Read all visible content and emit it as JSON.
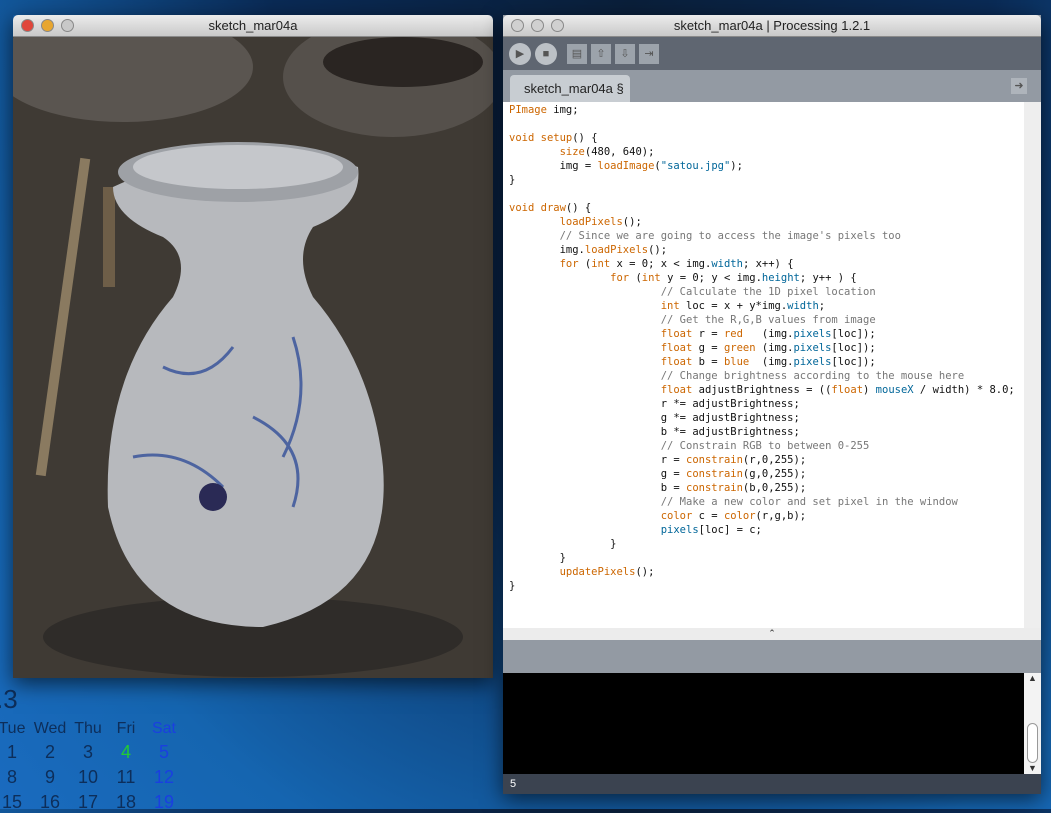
{
  "sketch_window": {
    "title": "sketch_mar04a"
  },
  "ide": {
    "title": "sketch_mar04a | Processing 1.2.1",
    "toolbar": {
      "run": "▶",
      "stop": "■",
      "new": "▤",
      "open": "⇧",
      "save": "⇩",
      "export": "⇥"
    },
    "tab_label": "sketch_mar04a §",
    "tab_menu": "➜",
    "status_line": "5",
    "code": [
      [
        [
          "PImage",
          "k"
        ],
        [
          " img;",
          ""
        ]
      ],
      [],
      [
        [
          "void",
          "k"
        ],
        [
          " ",
          ""
        ],
        [
          "setup",
          "k"
        ],
        [
          "() {",
          ""
        ]
      ],
      [
        [
          "\t",
          ""
        ],
        [
          "size",
          "k"
        ],
        [
          "(480, 640);",
          ""
        ]
      ],
      [
        [
          "\timg = ",
          ""
        ],
        [
          "loadImage",
          "k"
        ],
        [
          "(",
          ""
        ],
        [
          "\"satou.jpg\"",
          "s"
        ],
        [
          ");",
          ""
        ]
      ],
      [
        [
          "}",
          ""
        ]
      ],
      [],
      [
        [
          "void",
          "k"
        ],
        [
          " ",
          ""
        ],
        [
          "draw",
          "k"
        ],
        [
          "() {",
          ""
        ]
      ],
      [
        [
          "\t",
          ""
        ],
        [
          "loadPixels",
          "k"
        ],
        [
          "();",
          ""
        ]
      ],
      [
        [
          "\t",
          ""
        ],
        [
          "// Since we are going to access the image's pixels too",
          "c"
        ]
      ],
      [
        [
          "\timg.",
          ""
        ],
        [
          "loadPixels",
          "k"
        ],
        [
          "();",
          ""
        ]
      ],
      [
        [
          "\t",
          ""
        ],
        [
          "for",
          "k"
        ],
        [
          " (",
          ""
        ],
        [
          "int",
          "k"
        ],
        [
          " x = 0; x < img.",
          ""
        ],
        [
          "width",
          "b"
        ],
        [
          "; x++) {",
          ""
        ]
      ],
      [
        [
          "\t\t",
          ""
        ],
        [
          "for",
          "k"
        ],
        [
          " (",
          ""
        ],
        [
          "int",
          "k"
        ],
        [
          " y = 0; y < img.",
          ""
        ],
        [
          "height",
          "b"
        ],
        [
          "; y++ ) {",
          ""
        ]
      ],
      [
        [
          "\t\t\t",
          ""
        ],
        [
          "// Calculate the 1D pixel location",
          "c"
        ]
      ],
      [
        [
          "\t\t\t",
          ""
        ],
        [
          "int",
          "k"
        ],
        [
          " loc = x + y*img.",
          ""
        ],
        [
          "width",
          "b"
        ],
        [
          ";",
          ""
        ]
      ],
      [
        [
          "\t\t\t",
          ""
        ],
        [
          "// Get the R,G,B values from image",
          "c"
        ]
      ],
      [
        [
          "\t\t\t",
          ""
        ],
        [
          "float",
          "k"
        ],
        [
          " r = ",
          ""
        ],
        [
          "red",
          "k"
        ],
        [
          "   (img.",
          ""
        ],
        [
          "pixels",
          "b"
        ],
        [
          "[loc]);",
          ""
        ]
      ],
      [
        [
          "\t\t\t",
          ""
        ],
        [
          "float",
          "k"
        ],
        [
          " g = ",
          ""
        ],
        [
          "green",
          "k"
        ],
        [
          " (img.",
          ""
        ],
        [
          "pixels",
          "b"
        ],
        [
          "[loc]);",
          ""
        ]
      ],
      [
        [
          "\t\t\t",
          ""
        ],
        [
          "float",
          "k"
        ],
        [
          " b = ",
          ""
        ],
        [
          "blue",
          "k"
        ],
        [
          "  (img.",
          ""
        ],
        [
          "pixels",
          "b"
        ],
        [
          "[loc]);",
          ""
        ]
      ],
      [
        [
          "\t\t\t",
          ""
        ],
        [
          "// Change brightness according to the mouse here",
          "c"
        ]
      ],
      [
        [
          "\t\t\t",
          ""
        ],
        [
          "float",
          "k"
        ],
        [
          " adjustBrightness = ((",
          ""
        ],
        [
          "float",
          "k"
        ],
        [
          ") ",
          ""
        ],
        [
          "mouseX",
          "b"
        ],
        [
          " / width) * 8.0;",
          ""
        ]
      ],
      [
        [
          "\t\t\tr *= adjustBrightness;",
          ""
        ]
      ],
      [
        [
          "\t\t\tg *= adjustBrightness;",
          ""
        ]
      ],
      [
        [
          "\t\t\tb *= adjustBrightness;",
          ""
        ]
      ],
      [
        [
          "\t\t\t",
          ""
        ],
        [
          "// Constrain RGB to between 0-255",
          "c"
        ]
      ],
      [
        [
          "\t\t\tr = ",
          ""
        ],
        [
          "constrain",
          "k"
        ],
        [
          "(r,0,255);",
          ""
        ]
      ],
      [
        [
          "\t\t\tg = ",
          ""
        ],
        [
          "constrain",
          "k"
        ],
        [
          "(g,0,255);",
          ""
        ]
      ],
      [
        [
          "\t\t\tb = ",
          ""
        ],
        [
          "constrain",
          "k"
        ],
        [
          "(b,0,255);",
          ""
        ]
      ],
      [
        [
          "\t\t\t",
          ""
        ],
        [
          "// Make a new color and set pixel in the window",
          "c"
        ]
      ],
      [
        [
          "\t\t\t",
          ""
        ],
        [
          "color",
          "k"
        ],
        [
          " c = ",
          ""
        ],
        [
          "color",
          "k"
        ],
        [
          "(r,g,b);",
          ""
        ]
      ],
      [
        [
          "\t\t\t",
          ""
        ],
        [
          "pixels",
          "b"
        ],
        [
          "[loc] = c;",
          ""
        ]
      ],
      [
        [
          "\t\t}",
          ""
        ]
      ],
      [
        [
          "\t}",
          ""
        ]
      ],
      [
        [
          "\t",
          ""
        ],
        [
          "updatePixels",
          "k"
        ],
        [
          "();",
          ""
        ]
      ],
      [
        [
          "}",
          ""
        ]
      ]
    ]
  },
  "calendar": {
    "month": ".3",
    "days": [
      "Tue",
      "Wed",
      "Thu",
      "Fri",
      "Sat"
    ],
    "weeks": [
      [
        "1",
        "2",
        "3",
        "4",
        "5"
      ],
      [
        "8",
        "9",
        "10",
        "11",
        "12"
      ],
      [
        "15",
        "16",
        "17",
        "18",
        "19"
      ]
    ],
    "today_color": "#22cc33",
    "sat_color": "#1a3fe0"
  }
}
